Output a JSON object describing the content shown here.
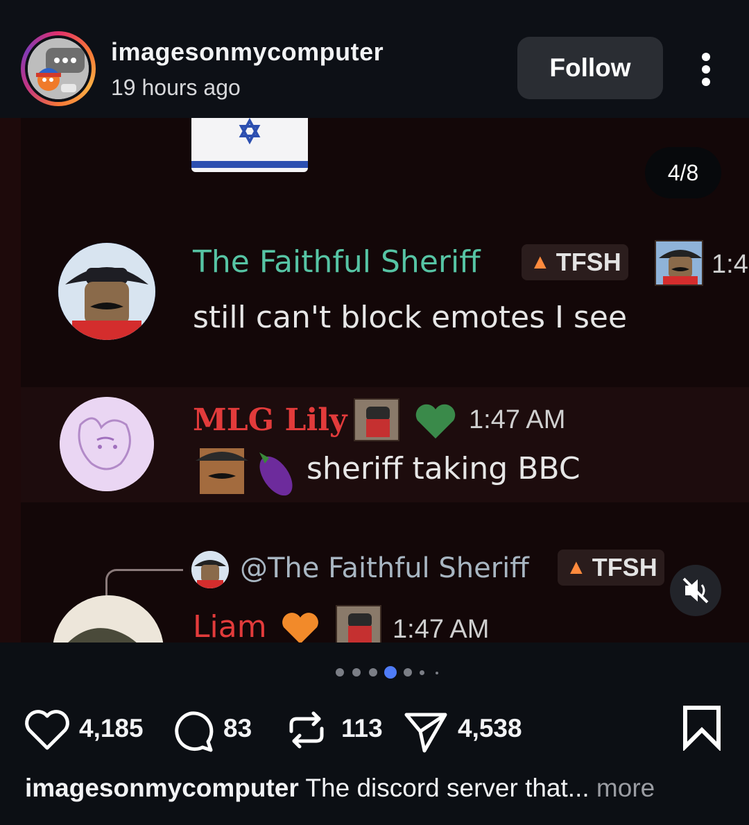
{
  "post": {
    "username": "imagesonmycomputer",
    "time_ago": "19 hours ago",
    "follow_label": "Follow",
    "more_icon": "kebab-vertical-icon"
  },
  "media": {
    "counter": "4/8",
    "carousel": {
      "total": 8,
      "active_index": 4
    },
    "muted": true,
    "messages": [
      {
        "display_name": "The Faithful Sheriff",
        "name_color": "#56c4a4",
        "tag": "TFSH",
        "timestamp": "1:4",
        "text": "still can't block emotes I see"
      },
      {
        "display_name": "MLG Lily",
        "name_color": "#e23b3b",
        "timestamp": "1:47 AM",
        "text": "sheriff taking BBC"
      },
      {
        "reply_to": "@The Faithful Sheriff",
        "reply_tag": "TFSH",
        "display_name": "Liam",
        "name_color": "#e23b3b",
        "timestamp": "1:47 AM"
      }
    ]
  },
  "actions": {
    "likes": "4,185",
    "comments": "83",
    "reposts": "113",
    "shares": "4,538"
  },
  "caption": {
    "username": "imagesonmycomputer",
    "text": "The discord server that...",
    "more_label": "more"
  },
  "colors": {
    "background": "#0c0f14",
    "follow_button": "#2a2d33",
    "active_dot": "#4f7cf7",
    "fire": "#ff8a3d"
  }
}
